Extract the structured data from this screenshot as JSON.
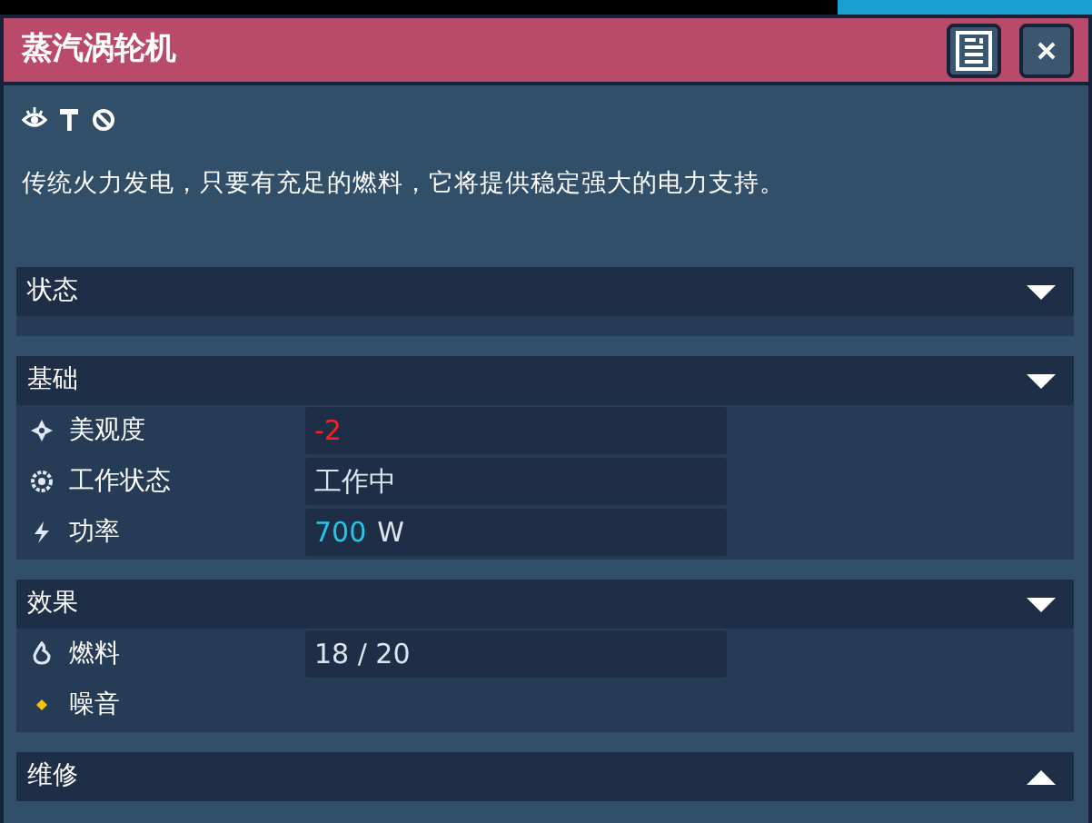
{
  "window": {
    "title": "蒸汽涡轮机"
  },
  "tags": [
    {
      "kind": "eye"
    },
    {
      "kind": "hammer"
    },
    {
      "kind": "forbidden"
    }
  ],
  "description": "传统火力发电，只要有充足的燃料，它将提供稳定强大的电力支持。",
  "sections": [
    {
      "title": "状态",
      "expanded": true
    },
    {
      "title": "基础",
      "expanded": true,
      "rows": [
        {
          "kind": "sparkle",
          "label": "美观度",
          "value": "-2",
          "color": "#ff1e1e"
        },
        {
          "kind": "gear",
          "label": "工作状态",
          "value": "工作中"
        },
        {
          "kind": "bolt",
          "label": "功率",
          "value": "700",
          "unit": "W",
          "color": "#26c6e6"
        }
      ]
    },
    {
      "title": "效果",
      "expanded": true,
      "rows": [
        {
          "kind": "flame",
          "label": "燃料",
          "value": "18 / 20"
        },
        {
          "kind": "diamond",
          "label": "噪音"
        }
      ]
    },
    {
      "title": "维修",
      "expanded": false
    }
  ]
}
